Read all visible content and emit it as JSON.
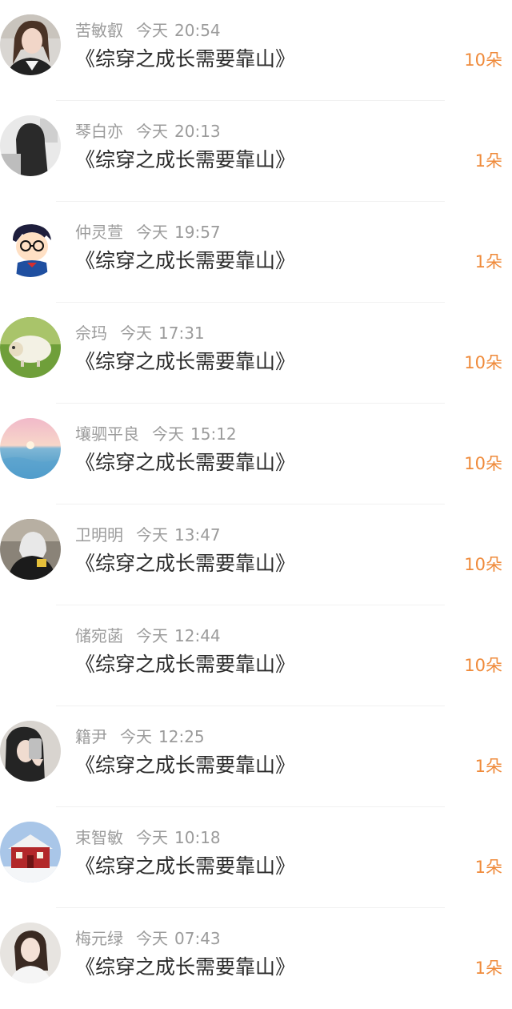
{
  "items": [
    {
      "name": "苦敏叡",
      "day": "今天",
      "time": "20:54",
      "title": "《综穿之成长需要靠山》",
      "gift": "10朵",
      "avatar_icon": "woman-photo-avatar-icon"
    },
    {
      "name": "琴白亦",
      "day": "今天",
      "time": "20:13",
      "title": "《综穿之成长需要靠山》",
      "gift": "1朵",
      "avatar_icon": "long-hair-photo-avatar-icon"
    },
    {
      "name": "仲灵萱",
      "day": "今天",
      "time": "19:57",
      "title": "《综穿之成长需要靠山》",
      "gift": "1朵",
      "avatar_icon": "cartoon-detective-avatar-icon"
    },
    {
      "name": "佘玛",
      "day": "今天",
      "time": "17:31",
      "title": "《综穿之成长需要靠山》",
      "gift": "10朵",
      "avatar_icon": "sheep-avatar-icon"
    },
    {
      "name": "壤驷平良",
      "day": "今天",
      "time": "15:12",
      "title": "《综穿之成长需要靠山》",
      "gift": "10朵",
      "avatar_icon": "sea-sunset-avatar-icon"
    },
    {
      "name": "卫明明",
      "day": "今天",
      "time": "13:47",
      "title": "《综穿之成长需要靠山》",
      "gift": "10朵",
      "avatar_icon": "hooded-person-avatar-icon"
    },
    {
      "name": "储宛菡",
      "day": "今天",
      "time": "12:44",
      "title": "《综穿之成长需要靠山》",
      "gift": "10朵",
      "avatar_icon": "blank-avatar-icon"
    },
    {
      "name": "籍尹",
      "day": "今天",
      "time": "12:25",
      "title": "《综穿之成长需要靠山》",
      "gift": "1朵",
      "avatar_icon": "selfie-avatar-icon"
    },
    {
      "name": "束智敏",
      "day": "今天",
      "time": "10:18",
      "title": "《综穿之成长需要靠山》",
      "gift": "1朵",
      "avatar_icon": "red-house-snow-avatar-icon"
    },
    {
      "name": "梅元绿",
      "day": "今天",
      "time": "07:43",
      "title": "《综穿之成长需要靠山》",
      "gift": "1朵",
      "avatar_icon": "girl-photo-avatar-icon"
    }
  ],
  "colors": {
    "accent": "#ef8a3a",
    "meta_text": "#9b9b9b",
    "title_text": "#2b2b2b",
    "divider": "#f1f1f1"
  }
}
